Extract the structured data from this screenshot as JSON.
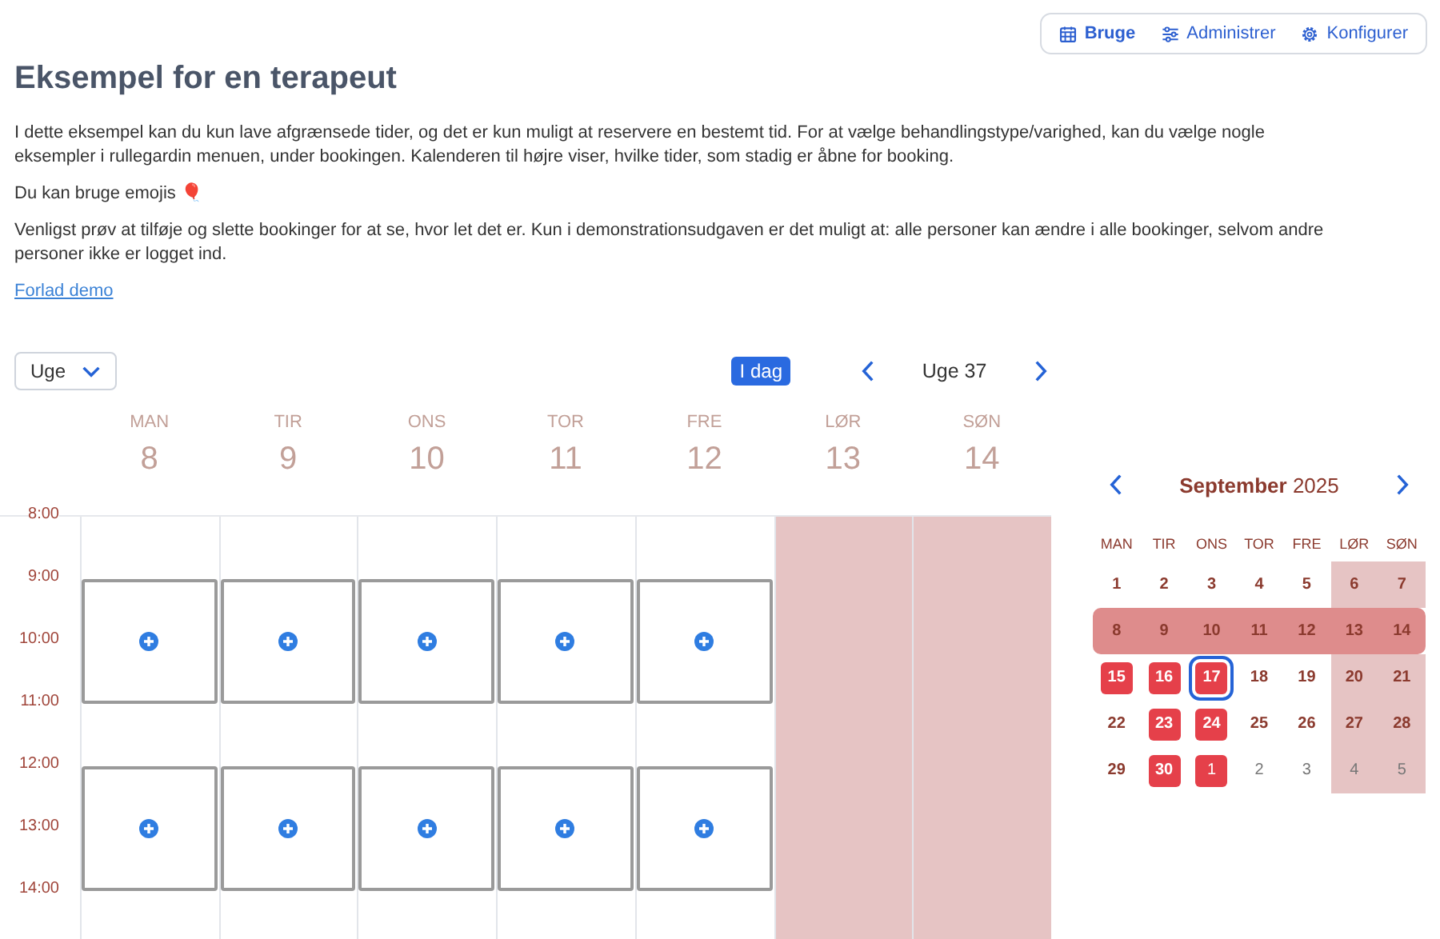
{
  "nav": [
    {
      "label": "Bruge",
      "selected": true
    },
    {
      "label": "Administrer",
      "selected": false
    },
    {
      "label": "Konfigurer",
      "selected": false
    }
  ],
  "title": "Eksempel for en terapeut",
  "paragraphs": [
    "I dette eksempel kan du kun lave afgrænsede tider, og det er kun muligt at reservere en bestemt tid. For at vælge behandlingstype/varighed, kan du vælge nogle eksempler i rullegardin menuen, under bookingen. Kalenderen til højre viser, hvilke tider, som stadig er åbne for booking.",
    "Du kan bruge emojis 🎈",
    "Venligst prøv at tilføje og slette bookinger for at se, hvor let det er. Kun i demonstrationsudgaven er det muligt at: alle personer kan ændre i alle bookinger, selvom andre personer ikke er logget ind."
  ],
  "link": "Forlad demo",
  "toolbar": {
    "view_select": "Uge",
    "today_button": "I dag",
    "week_label": "Uge 37"
  },
  "hours": [
    "8:00",
    "9:00",
    "10:00",
    "11:00",
    "12:00",
    "13:00",
    "14:00"
  ],
  "days": [
    {
      "name": "MAN",
      "date": "8",
      "closed": false,
      "hours": [
        {
          "kind": "free"
        },
        {
          "kind": "start"
        },
        {
          "kind": "cont"
        },
        {
          "kind": "free"
        },
        {
          "kind": "start"
        },
        {
          "kind": "cont"
        },
        {
          "kind": "free"
        }
      ]
    },
    {
      "name": "TIR",
      "date": "9",
      "closed": false,
      "hours": [
        {
          "kind": "free"
        },
        {
          "kind": "start"
        },
        {
          "kind": "cont"
        },
        {
          "kind": "free"
        },
        {
          "kind": "start"
        },
        {
          "kind": "cont"
        },
        {
          "kind": "free"
        }
      ]
    },
    {
      "name": "ONS",
      "date": "10",
      "closed": false,
      "hours": [
        {
          "kind": "free"
        },
        {
          "kind": "start"
        },
        {
          "kind": "cont"
        },
        {
          "kind": "free"
        },
        {
          "kind": "start"
        },
        {
          "kind": "cont"
        },
        {
          "kind": "free"
        }
      ]
    },
    {
      "name": "TOR",
      "date": "11",
      "closed": false,
      "hours": [
        {
          "kind": "free"
        },
        {
          "kind": "start"
        },
        {
          "kind": "cont"
        },
        {
          "kind": "free"
        },
        {
          "kind": "start"
        },
        {
          "kind": "cont"
        },
        {
          "kind": "free"
        }
      ]
    },
    {
      "name": "FRE",
      "date": "12",
      "closed": false,
      "hours": [
        {
          "kind": "free"
        },
        {
          "kind": "start"
        },
        {
          "kind": "cont"
        },
        {
          "kind": "free"
        },
        {
          "kind": "start"
        },
        {
          "kind": "cont"
        },
        {
          "kind": "free"
        }
      ]
    },
    {
      "name": "LØR",
      "date": "13",
      "closed": true,
      "hours": [
        {
          "kind": "free"
        },
        {
          "kind": "free"
        },
        {
          "kind": "free"
        },
        {
          "kind": "free"
        },
        {
          "kind": "free"
        },
        {
          "kind": "free"
        },
        {
          "kind": "free"
        }
      ]
    },
    {
      "name": "SØN",
      "date": "14",
      "closed": true,
      "hours": [
        {
          "kind": "free"
        },
        {
          "kind": "free"
        },
        {
          "kind": "free"
        },
        {
          "kind": "free"
        },
        {
          "kind": "free"
        },
        {
          "kind": "free"
        },
        {
          "kind": "free"
        }
      ]
    }
  ],
  "mini_calendar": {
    "month": "September",
    "year": "2025",
    "weekdays": [
      {
        "label": "MAN",
        "weekend": false
      },
      {
        "label": "TIR",
        "weekend": false
      },
      {
        "label": "ONS",
        "weekend": false
      },
      {
        "label": "TOR",
        "weekend": false
      },
      {
        "label": "FRE",
        "weekend": false
      },
      {
        "label": "LØR",
        "weekend": true
      },
      {
        "label": "SØN",
        "weekend": true
      }
    ],
    "weeks": [
      {
        "current": false,
        "days": [
          {
            "day": "1",
            "other_month": false,
            "booked": false,
            "today": false
          },
          {
            "day": "2",
            "other_month": false,
            "booked": false,
            "today": false
          },
          {
            "day": "3",
            "other_month": false,
            "booked": false,
            "today": false
          },
          {
            "day": "4",
            "other_month": false,
            "booked": false,
            "today": false
          },
          {
            "day": "5",
            "other_month": false,
            "booked": false,
            "today": false
          },
          {
            "day": "6",
            "other_month": false,
            "booked": false,
            "today": false
          },
          {
            "day": "7",
            "other_month": false,
            "booked": false,
            "today": false
          }
        ]
      },
      {
        "current": true,
        "days": [
          {
            "day": "8",
            "other_month": false,
            "booked": false,
            "today": false
          },
          {
            "day": "9",
            "other_month": false,
            "booked": false,
            "today": false
          },
          {
            "day": "10",
            "other_month": false,
            "booked": false,
            "today": false
          },
          {
            "day": "11",
            "other_month": false,
            "booked": false,
            "today": false
          },
          {
            "day": "12",
            "other_month": false,
            "booked": false,
            "today": false
          },
          {
            "day": "13",
            "other_month": false,
            "booked": false,
            "today": false
          },
          {
            "day": "14",
            "other_month": false,
            "booked": false,
            "today": false
          }
        ]
      },
      {
        "current": false,
        "days": [
          {
            "day": "15",
            "other_month": false,
            "booked": true,
            "today": false
          },
          {
            "day": "16",
            "other_month": false,
            "booked": true,
            "today": false
          },
          {
            "day": "17",
            "other_month": false,
            "booked": true,
            "today": true
          },
          {
            "day": "18",
            "other_month": false,
            "booked": false,
            "today": false
          },
          {
            "day": "19",
            "other_month": false,
            "booked": false,
            "today": false
          },
          {
            "day": "20",
            "other_month": false,
            "booked": false,
            "today": false
          },
          {
            "day": "21",
            "other_month": false,
            "booked": false,
            "today": false
          }
        ]
      },
      {
        "current": false,
        "days": [
          {
            "day": "22",
            "other_month": false,
            "booked": false,
            "today": false
          },
          {
            "day": "23",
            "other_month": false,
            "booked": true,
            "today": false
          },
          {
            "day": "24",
            "other_month": false,
            "booked": true,
            "today": false
          },
          {
            "day": "25",
            "other_month": false,
            "booked": false,
            "today": false
          },
          {
            "day": "26",
            "other_month": false,
            "booked": false,
            "today": false
          },
          {
            "day": "27",
            "other_month": false,
            "booked": false,
            "today": false
          },
          {
            "day": "28",
            "other_month": false,
            "booked": false,
            "today": false
          }
        ]
      },
      {
        "current": false,
        "days": [
          {
            "day": "29",
            "other_month": false,
            "booked": false,
            "today": false
          },
          {
            "day": "30",
            "other_month": false,
            "booked": true,
            "today": false
          },
          {
            "day": "1",
            "other_month": true,
            "booked": true,
            "today": false
          },
          {
            "day": "2",
            "other_month": true,
            "booked": false,
            "today": false
          },
          {
            "day": "3",
            "other_month": true,
            "booked": false,
            "today": false
          },
          {
            "day": "4",
            "other_month": true,
            "booked": false,
            "today": false
          },
          {
            "day": "5",
            "other_month": true,
            "booked": false,
            "today": false
          }
        ]
      }
    ]
  }
}
